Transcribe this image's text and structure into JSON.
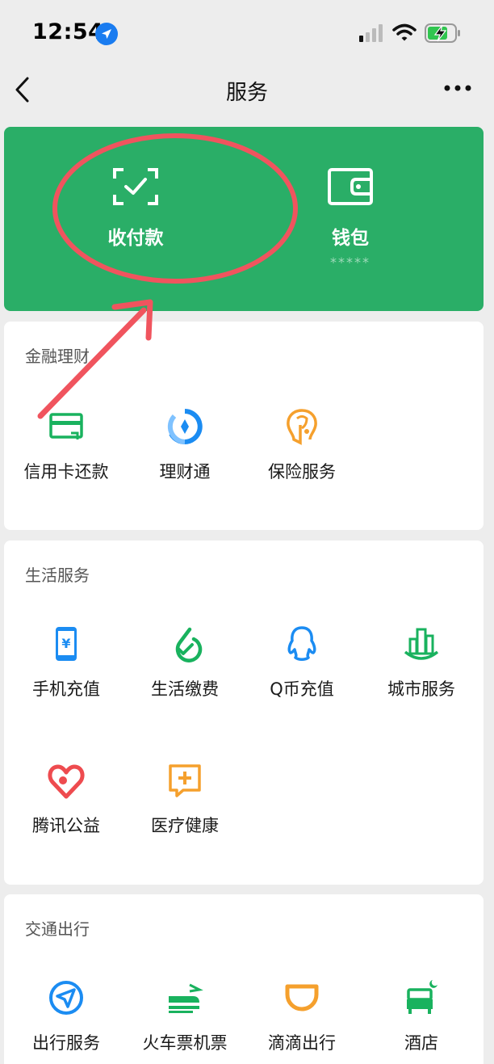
{
  "status_bar": {
    "time": "12:54"
  },
  "nav": {
    "title": "服务"
  },
  "wallet": {
    "pay": {
      "label": "收付款"
    },
    "wallet": {
      "label": "钱包",
      "balance": "*****"
    }
  },
  "sections": {
    "finance": {
      "title": "金融理财",
      "items": [
        {
          "label": "信用卡还款",
          "icon": "credit-card-icon"
        },
        {
          "label": "理财通",
          "icon": "wealth-icon"
        },
        {
          "label": "保险服务",
          "icon": "insurance-icon"
        }
      ]
    },
    "life": {
      "title": "生活服务",
      "items": [
        {
          "label": "手机充值",
          "icon": "phone-topup-icon"
        },
        {
          "label": "生活缴费",
          "icon": "utility-bill-icon"
        },
        {
          "label": "Q币充值",
          "icon": "qq-coin-icon"
        },
        {
          "label": "城市服务",
          "icon": "city-service-icon"
        },
        {
          "label": "腾讯公益",
          "icon": "charity-heart-icon"
        },
        {
          "label": "医疗健康",
          "icon": "medical-icon"
        }
      ]
    },
    "transport": {
      "title": "交通出行",
      "items": [
        {
          "label": "出行服务",
          "icon": "travel-service-icon"
        },
        {
          "label": "火车票机票",
          "icon": "train-ticket-icon"
        },
        {
          "label": "滴滴出行",
          "icon": "didi-icon"
        },
        {
          "label": "酒店",
          "icon": "hotel-icon"
        }
      ]
    }
  },
  "colors": {
    "wallet_green": "#2aae67",
    "annotation_red": "#f0545e",
    "icon_green": "#19b25e",
    "icon_blue": "#1b8cf2",
    "icon_orange": "#f5a02d",
    "icon_red": "#ee4b4f"
  }
}
